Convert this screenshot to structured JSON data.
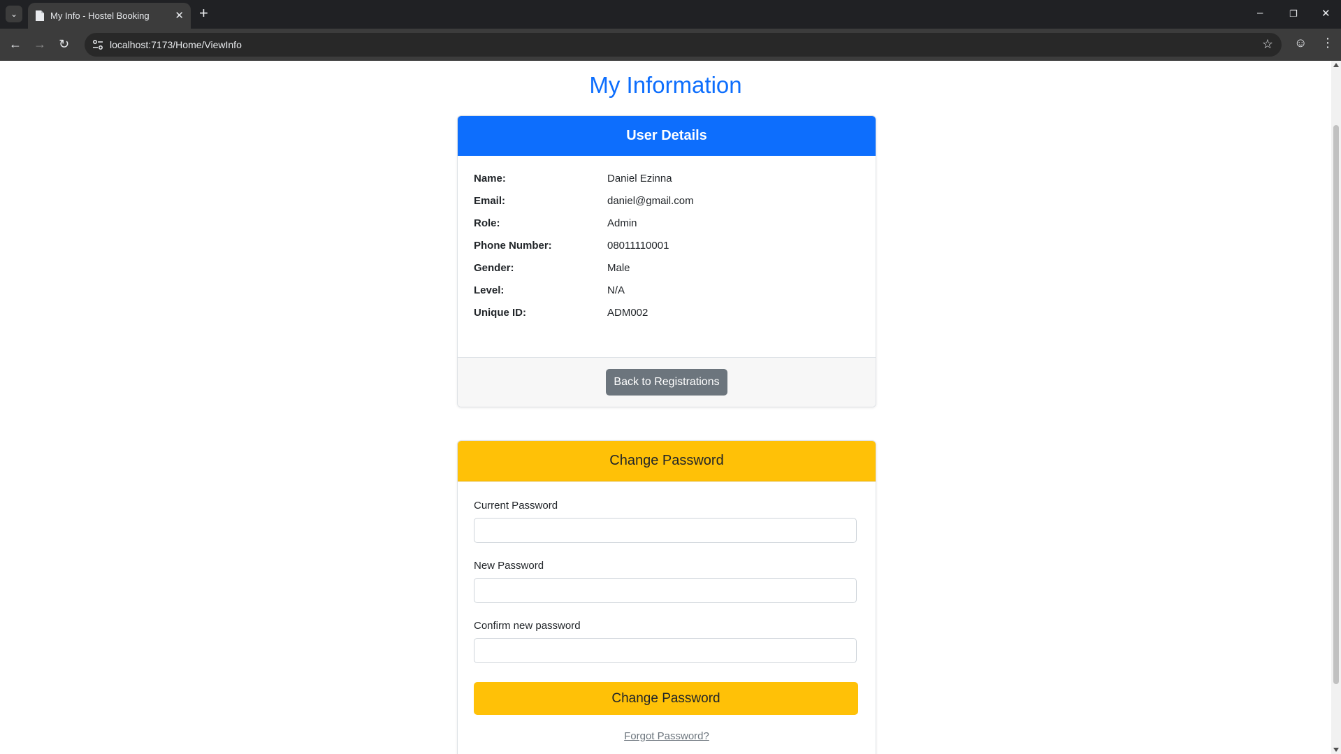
{
  "browser": {
    "tab_title": "My Info - Hostel Booking",
    "url": "localhost:7173/Home/ViewInfo"
  },
  "page": {
    "title": "My Information"
  },
  "user_details": {
    "header": "User Details",
    "rows": [
      {
        "label": "Name:",
        "value": "Daniel Ezinna"
      },
      {
        "label": "Email:",
        "value": "daniel@gmail.com"
      },
      {
        "label": "Role:",
        "value": "Admin"
      },
      {
        "label": "Phone Number:",
        "value": "08011110001"
      },
      {
        "label": "Gender:",
        "value": "Male"
      },
      {
        "label": "Level:",
        "value": "N/A"
      },
      {
        "label": "Unique ID:",
        "value": "ADM002"
      }
    ],
    "back_button": "Back to Registrations"
  },
  "change_password": {
    "header": "Change Password",
    "current_label": "Current Password",
    "new_label": "New Password",
    "confirm_label": "Confirm new password",
    "current_value": "",
    "new_value": "",
    "confirm_value": "",
    "submit_button": "Change Password",
    "forgot_link": "Forgot Password?"
  },
  "colors": {
    "primary": "#0d6efd",
    "warning": "#ffc107",
    "secondary": "#6c757d"
  }
}
